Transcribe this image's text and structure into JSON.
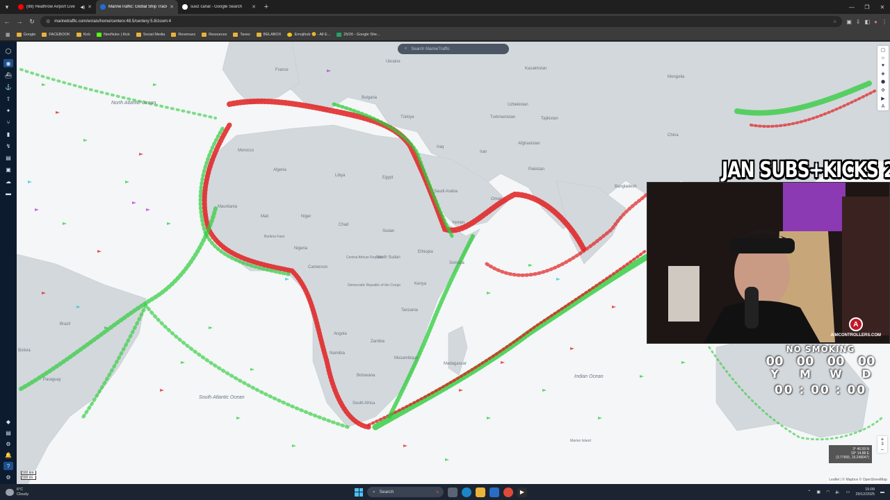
{
  "browser": {
    "tabs": [
      {
        "label": "(98) Heathrow Airport Live",
        "favicon_color": "#ff0000",
        "active": false
      },
      {
        "label": "MarineTraffic: Global Ship Track",
        "favicon_color": "#1d6fd8",
        "active": true
      },
      {
        "label": "suez canal - Google Search",
        "favicon_color": "#ffffff",
        "active": false
      }
    ],
    "url": "marinetraffic.com/en/ais/home/centerx:48.5/centery:5.8/zoom:4",
    "bookmarks": [
      {
        "label": "Google",
        "color": "#e9b23a"
      },
      {
        "label": "FACEBOOK",
        "color": "#e9b23a"
      },
      {
        "label": "Kick",
        "color": "#e9b23a"
      },
      {
        "label": "NeoNuke | Kick",
        "color": "#53fc18"
      },
      {
        "label": "Social Media",
        "color": "#e9b23a"
      },
      {
        "label": "Revenues",
        "color": "#e9b23a"
      },
      {
        "label": "Resources",
        "color": "#e9b23a"
      },
      {
        "label": "Taxes",
        "color": "#e9b23a"
      },
      {
        "label": "BELABOX",
        "color": "#e9b23a"
      },
      {
        "label": "Emojihub 😊 - All E...",
        "color": "#f5c518"
      },
      {
        "label": "25/26 - Google She...",
        "color": "#1fa463"
      }
    ]
  },
  "map": {
    "search_placeholder": "Search MarineTraffic",
    "coords": {
      "line1": "3° 46.59 N",
      "line2": "19° 14.88 E",
      "line3": "(3.77655, 19.248047)"
    },
    "scale": {
      "km": "500 km",
      "mi": "500 mi"
    },
    "attribution": "Leaflet | © Mapbox © OpenStreetMap",
    "zoom_level": "3",
    "labels": [
      {
        "text": "Ukraine"
      },
      {
        "text": "Kazakhstan"
      },
      {
        "text": "Mongolia"
      },
      {
        "text": "Uzbekistan"
      },
      {
        "text": "Turkmenistan"
      },
      {
        "text": "Tajikistan"
      },
      {
        "text": "China"
      },
      {
        "text": "Afghanistan"
      },
      {
        "text": "Pakistan"
      },
      {
        "text": "Iran"
      },
      {
        "text": "Iraq"
      },
      {
        "text": "Türkiye"
      },
      {
        "text": "Algeria"
      },
      {
        "text": "Libya"
      },
      {
        "text": "Egypt"
      },
      {
        "text": "Morocco"
      },
      {
        "text": "Saudi Arabia"
      },
      {
        "text": "Oman"
      },
      {
        "text": "Yemen"
      },
      {
        "text": "Mauritania"
      },
      {
        "text": "Mali"
      },
      {
        "text": "Niger"
      },
      {
        "text": "Chad"
      },
      {
        "text": "Sudan"
      },
      {
        "text": "Nigeria"
      },
      {
        "text": "Ethiopia"
      },
      {
        "text": "South Sudan"
      },
      {
        "text": "Cameroon"
      },
      {
        "text": "Somalia"
      },
      {
        "text": "Kenya"
      },
      {
        "text": "Democratic Republic of the Congo"
      },
      {
        "text": "Tanzania"
      },
      {
        "text": "Angola"
      },
      {
        "text": "Zambia"
      },
      {
        "text": "Namibia"
      },
      {
        "text": "Botswana"
      },
      {
        "text": "Mozambique"
      },
      {
        "text": "Madagascar"
      },
      {
        "text": "South Africa"
      },
      {
        "text": "Brazil"
      },
      {
        "text": "Bolivia"
      },
      {
        "text": "Paraguay"
      },
      {
        "text": "North Atlantic Ocean"
      },
      {
        "text": "South Atlantic Ocean"
      },
      {
        "text": "Indian Ocean"
      },
      {
        "text": "Bangladesh"
      },
      {
        "text": "Burkina Faso"
      },
      {
        "text": "Central African Republic"
      },
      {
        "text": "Marion Island"
      },
      {
        "text": "France"
      },
      {
        "text": "Bulgaria"
      }
    ]
  },
  "overlay": {
    "banner": "JAN SUBS+KICKS 2/100",
    "webcam_brand": "AIMCONTROLLERS.COM",
    "webcam_logo_letter": "A",
    "timer": {
      "title": "NO SMOKING",
      "units": [
        {
          "value": "00",
          "unit": "Y"
        },
        {
          "value": "00",
          "unit": "M"
        },
        {
          "value": "00",
          "unit": "W"
        },
        {
          "value": "00",
          "unit": "D"
        }
      ],
      "clock": "00 : 00 : 00"
    }
  },
  "taskbar": {
    "weather_temp": "6°C",
    "weather_desc": "Cloudy",
    "search_label": "Search",
    "time": "15:09",
    "date": "29/12/2025"
  }
}
